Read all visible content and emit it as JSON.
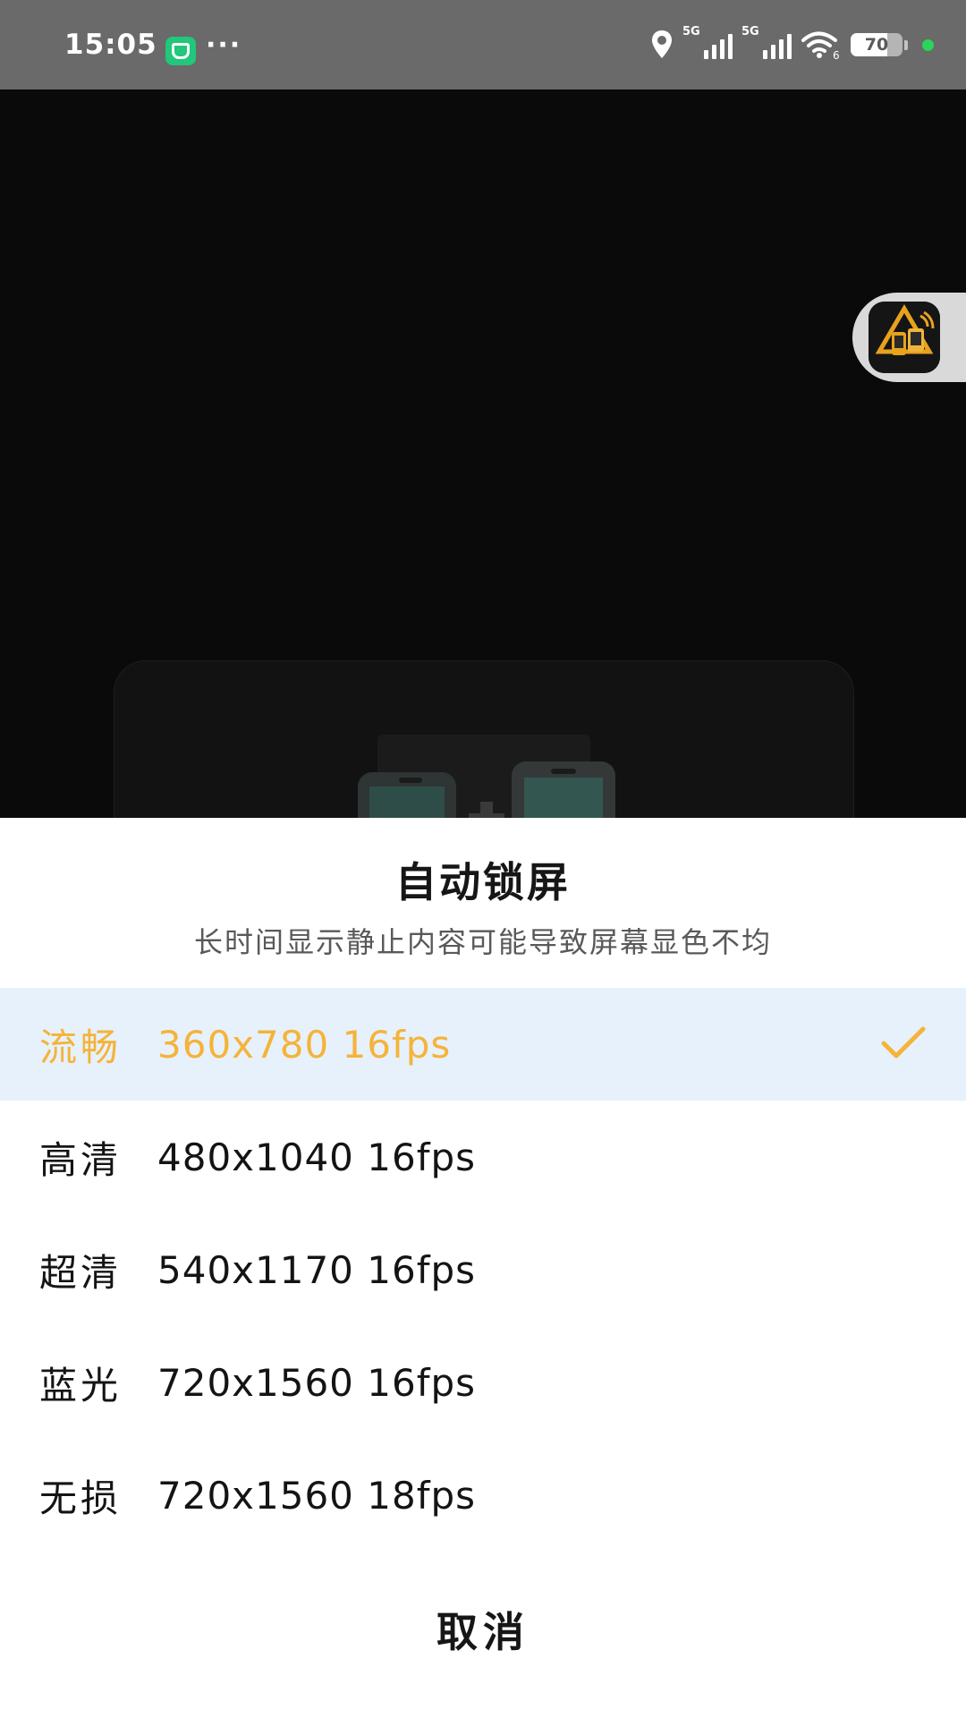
{
  "status_bar": {
    "time": "15:05",
    "more": "···",
    "signal_1_tag": "5G",
    "signal_2_tag": "5G",
    "wifi_suffix": "6",
    "battery_percent": 70,
    "battery_label": "70",
    "icons": [
      "app-badge-icon",
      "location-icon",
      "signal-icon",
      "wifi-icon",
      "battery-icon"
    ]
  },
  "floating_button": {
    "icon": "assistant-app-icon"
  },
  "sheet": {
    "title": "自动锁屏",
    "subtitle": "长时间显示静止内容可能导致屏幕显色不均",
    "options": [
      {
        "name": "流畅",
        "spec": "360x780 16fps",
        "selected": true
      },
      {
        "name": "高清",
        "spec": "480x1040 16fps",
        "selected": false
      },
      {
        "name": "超清",
        "spec": "540x1170 16fps",
        "selected": false
      },
      {
        "name": "蓝光",
        "spec": "720x1560 16fps",
        "selected": false
      },
      {
        "name": "无损",
        "spec": "720x1560 18fps",
        "selected": false
      }
    ],
    "cancel_label": "取消"
  },
  "colors": {
    "selected_text": "#f5b339",
    "selected_bg": "#e6f1fb",
    "status_bar_bg": "#6a6a6a",
    "online_dot": "#2bd45a"
  }
}
